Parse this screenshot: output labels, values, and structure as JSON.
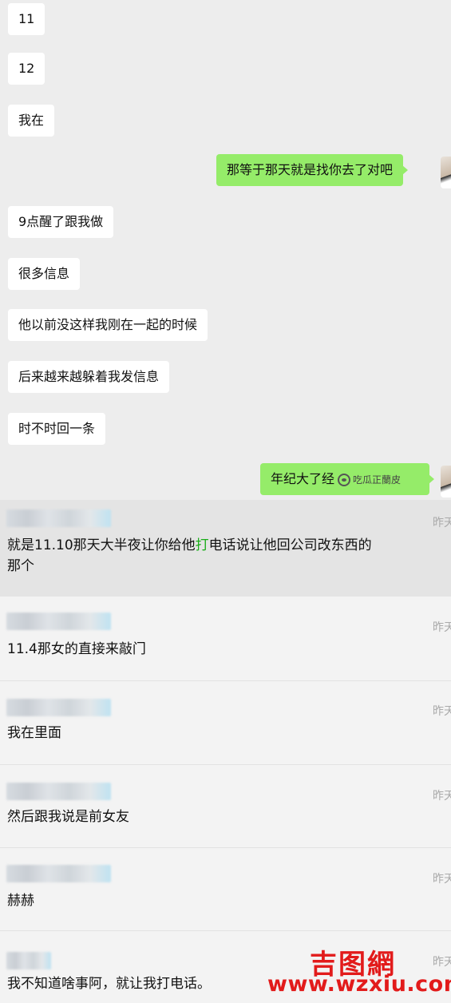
{
  "chat": {
    "messages": [
      {
        "side": "left",
        "text": "11"
      },
      {
        "side": "left",
        "text": "12"
      },
      {
        "side": "left",
        "text": "我在"
      },
      {
        "side": "right",
        "text": "那等于那天就是找你去了对吧"
      },
      {
        "side": "left",
        "text": "9点醒了跟我做"
      },
      {
        "side": "left",
        "text": "很多信息"
      },
      {
        "side": "left",
        "text": "他以前没这样我刚在一起的时候"
      },
      {
        "side": "left",
        "text": "后来越来越躲着我发信息"
      },
      {
        "side": "left",
        "text": "时不时回一条"
      },
      {
        "side": "right",
        "text": "年纪大了经"
      }
    ],
    "watermark": "吃瓜正蘭皮",
    "colors": {
      "background": "#ededed",
      "left_bubble": "#ffffff",
      "right_bubble": "#95ec69"
    }
  },
  "comments": {
    "items": [
      {
        "time": "昨天",
        "text_before": "就是11.10那天大半夜让你给他",
        "text_highlight": "打",
        "text_after": "电话说让他回公司改东西的那个"
      },
      {
        "time": "昨天",
        "text": "11.4那女的直接来敲门"
      },
      {
        "time": "昨天",
        "text": "我在里面"
      },
      {
        "time": "昨天",
        "text": "然后跟我说是前女友"
      },
      {
        "time": "昨天",
        "text": "赫赫"
      },
      {
        "time": "昨天",
        "text": "我不知道啥事阿，就让我打电话。"
      }
    ],
    "colors": {
      "highlight": "#1aad19",
      "background": "#f3f3f3"
    }
  },
  "site_watermark": {
    "logo": "吉图網",
    "url": "www.wzxiu.com",
    "color": "#e21b1b"
  }
}
